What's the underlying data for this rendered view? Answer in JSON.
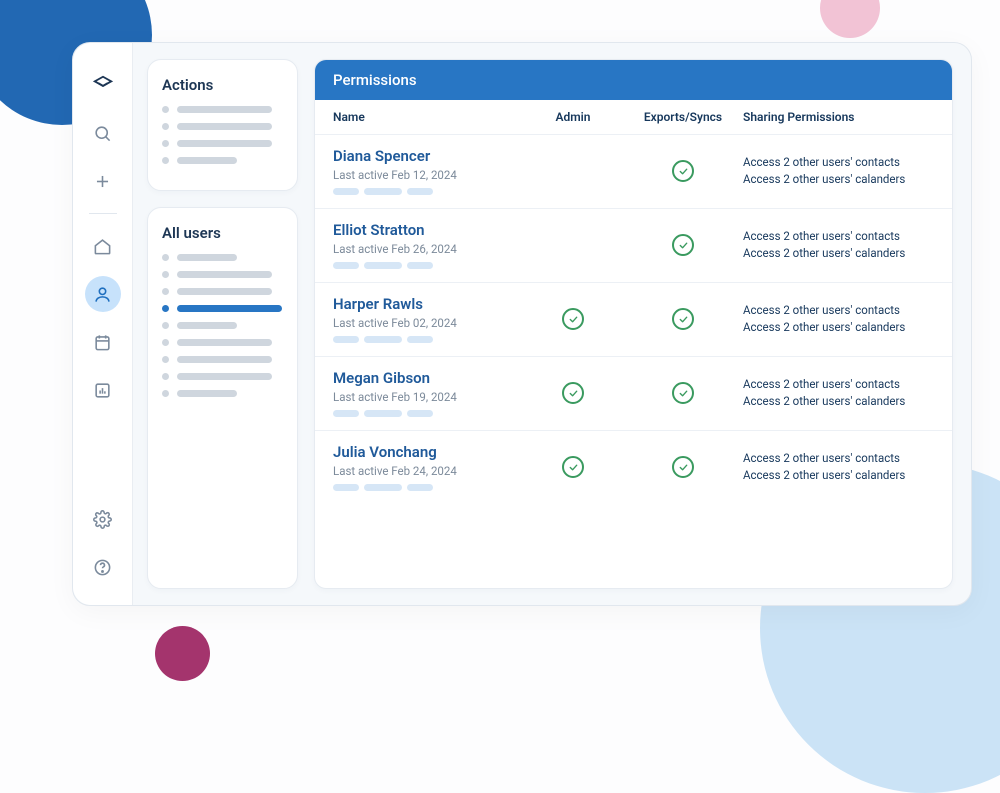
{
  "sidebar": {
    "actions_title": "Actions",
    "users_title": "All users"
  },
  "panel": {
    "title": "Permissions",
    "columns": {
      "name": "Name",
      "admin": "Admin",
      "exports": "Exports/Syncs",
      "sharing": "Sharing Permissions"
    }
  },
  "users": [
    {
      "name": "Diana Spencer",
      "last_active": "Last active Feb 12, 2024",
      "admin": false,
      "exports": true,
      "perm1": "Access 2 other users' contacts",
      "perm2": "Access 2 other users' calanders"
    },
    {
      "name": "Elliot Stratton",
      "last_active": "Last active Feb 26, 2024",
      "admin": false,
      "exports": true,
      "perm1": "Access 2 other users' contacts",
      "perm2": "Access 2 other users' calanders"
    },
    {
      "name": "Harper Rawls",
      "last_active": "Last active Feb 02, 2024",
      "admin": true,
      "exports": true,
      "perm1": "Access 2 other users' contacts",
      "perm2": "Access 2 other users' calanders"
    },
    {
      "name": "Megan Gibson",
      "last_active": "Last active Feb 19, 2024",
      "admin": true,
      "exports": true,
      "perm1": "Access 2 other users' contacts",
      "perm2": "Access 2 other users' calanders"
    },
    {
      "name": "Julia Vonchang",
      "last_active": "Last active Feb 24, 2024",
      "admin": true,
      "exports": true,
      "perm1": "Access 2 other users' contacts",
      "perm2": "Access 2 other users' calanders"
    }
  ]
}
